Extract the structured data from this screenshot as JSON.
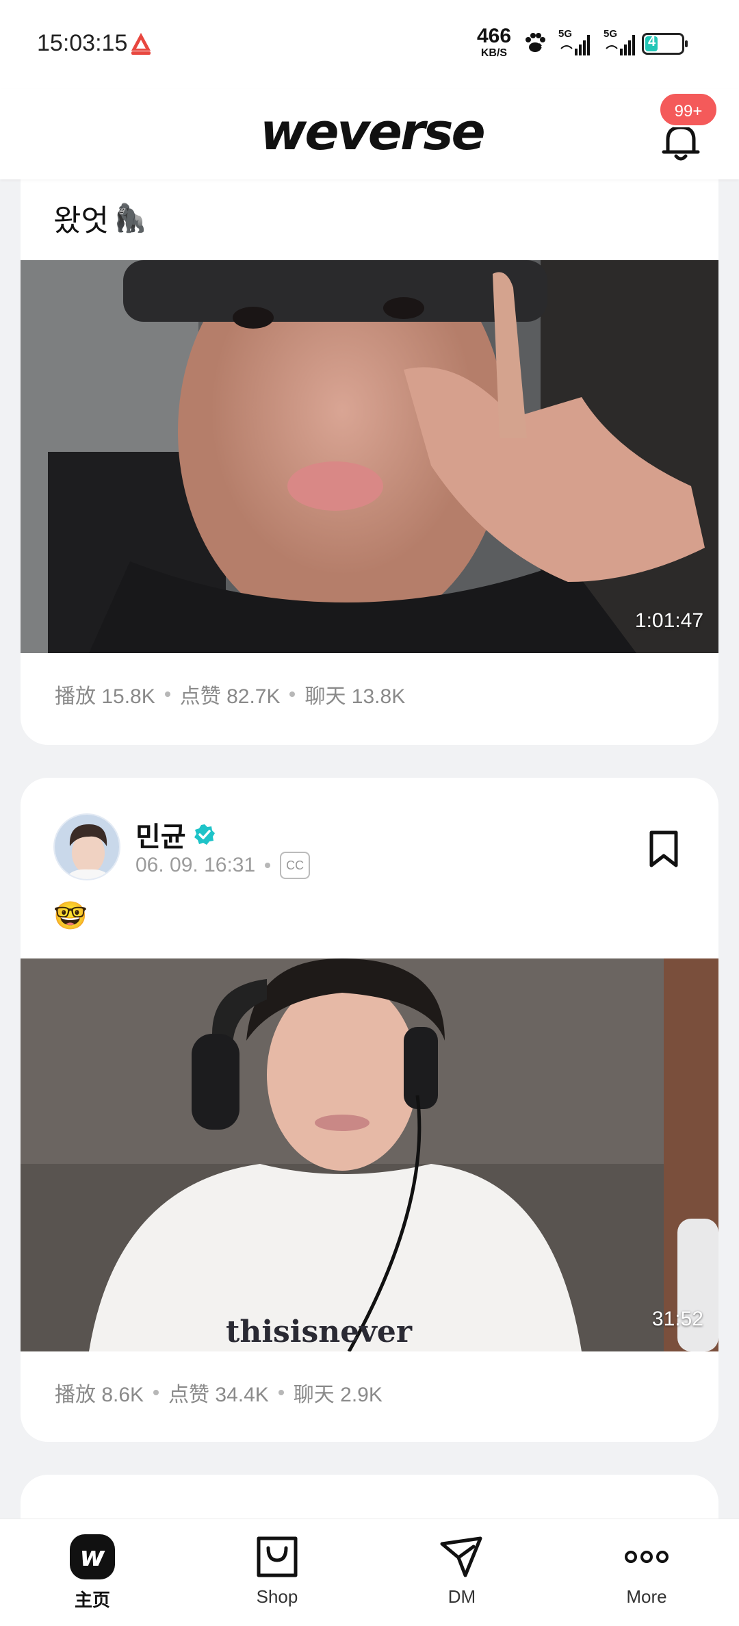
{
  "status_bar": {
    "time": "15:03:15",
    "net_speed": "466",
    "net_unit": "KB/S",
    "sim1": "5G",
    "sim2": "5G",
    "battery": "4"
  },
  "header": {
    "logo": "weverse",
    "notification_badge": "99+"
  },
  "posts": [
    {
      "caption": "왔엇",
      "caption_emoji": "🦍",
      "duration": "1:01:47",
      "stats": {
        "plays": "播放 15.8K",
        "likes": "点赞 82.7K",
        "chats": "聊天 13.8K"
      }
    },
    {
      "author": "민균",
      "verified": true,
      "date": "06. 09. 16:31",
      "cc_label": "CC",
      "caption": "🤓",
      "duration": "31:52",
      "stats": {
        "plays": "播放 8.6K",
        "likes": "点赞 34.4K",
        "chats": "聊天 2.9K"
      }
    }
  ],
  "bottom_nav": [
    {
      "label": "主页",
      "icon": "weverse-home-icon",
      "active": true
    },
    {
      "label": "Shop",
      "icon": "shopping-bag-icon",
      "active": false
    },
    {
      "label": "DM",
      "icon": "send-icon",
      "active": false
    },
    {
      "label": "More",
      "icon": "more-dots-icon",
      "active": false
    }
  ],
  "colors": {
    "badge": "#f45a5a",
    "verified": "#1ec3c8",
    "accent": "#23c6b7"
  }
}
